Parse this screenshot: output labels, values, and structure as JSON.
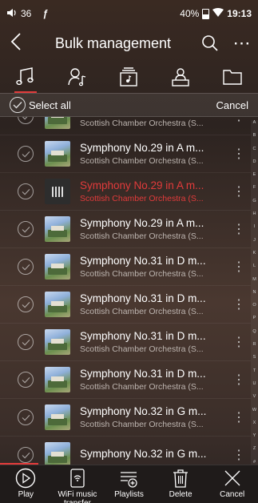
{
  "status": {
    "volume_level": "36",
    "battery_percent": "40%",
    "time": "19:13"
  },
  "header": {
    "title": "Bulk management"
  },
  "tabs": [
    {
      "icon": "music-note-icon",
      "active": true
    },
    {
      "icon": "artist-icon",
      "active": false
    },
    {
      "icon": "album-icon",
      "active": false
    },
    {
      "icon": "composer-icon",
      "active": false
    },
    {
      "icon": "folder-icon",
      "active": false
    }
  ],
  "selectbar": {
    "select_all_label": "Select all",
    "cancel_label": "Cancel"
  },
  "tracks": [
    {
      "title": "Symphony No.29 in A m...",
      "artist": "Scottish Chamber Orchestra (S...",
      "playing": false,
      "thumb": "album-art"
    },
    {
      "title": "Symphony No.29 in A m...",
      "artist": "Scottish Chamber Orchestra (S...",
      "playing": false,
      "thumb": "album-art"
    },
    {
      "title": "Symphony No.29 in A m...",
      "artist": "Scottish Chamber Orchestra (S...",
      "playing": true,
      "thumb": "playing-bars"
    },
    {
      "title": "Symphony No.29 in A m...",
      "artist": "Scottish Chamber Orchestra (S...",
      "playing": false,
      "thumb": "album-art"
    },
    {
      "title": "Symphony No.31 in D m...",
      "artist": "Scottish Chamber Orchestra (S...",
      "playing": false,
      "thumb": "album-art"
    },
    {
      "title": "Symphony No.31 in D m...",
      "artist": "Scottish Chamber Orchestra (S...",
      "playing": false,
      "thumb": "album-art"
    },
    {
      "title": "Symphony No.31 in D m...",
      "artist": "Scottish Chamber Orchestra (S...",
      "playing": false,
      "thumb": "album-art"
    },
    {
      "title": "Symphony No.31 in D m...",
      "artist": "Scottish Chamber Orchestra (S...",
      "playing": false,
      "thumb": "album-art"
    },
    {
      "title": "Symphony No.32 in G m...",
      "artist": "Scottish Chamber Orchestra (S...",
      "playing": false,
      "thumb": "album-art"
    },
    {
      "title": "Symphony No.32 in G m...",
      "artist": "",
      "playing": false,
      "thumb": "album-art"
    }
  ],
  "alphabet": [
    "A",
    "B",
    "C",
    "D",
    "E",
    "F",
    "G",
    "H",
    "I",
    "J",
    "K",
    "L",
    "M",
    "N",
    "O",
    "P",
    "Q",
    "R",
    "S",
    "T",
    "U",
    "V",
    "W",
    "X",
    "Y",
    "Z",
    "#"
  ],
  "bottom_bar": {
    "play_label": "Play",
    "wifi_label": "WiFi music transfer",
    "playlists_label": "Playlists",
    "delete_label": "Delete",
    "cancel_label": "Cancel"
  },
  "colors": {
    "accent": "#e23b3b",
    "bottom_bar_bg": "#1f1b1a"
  }
}
